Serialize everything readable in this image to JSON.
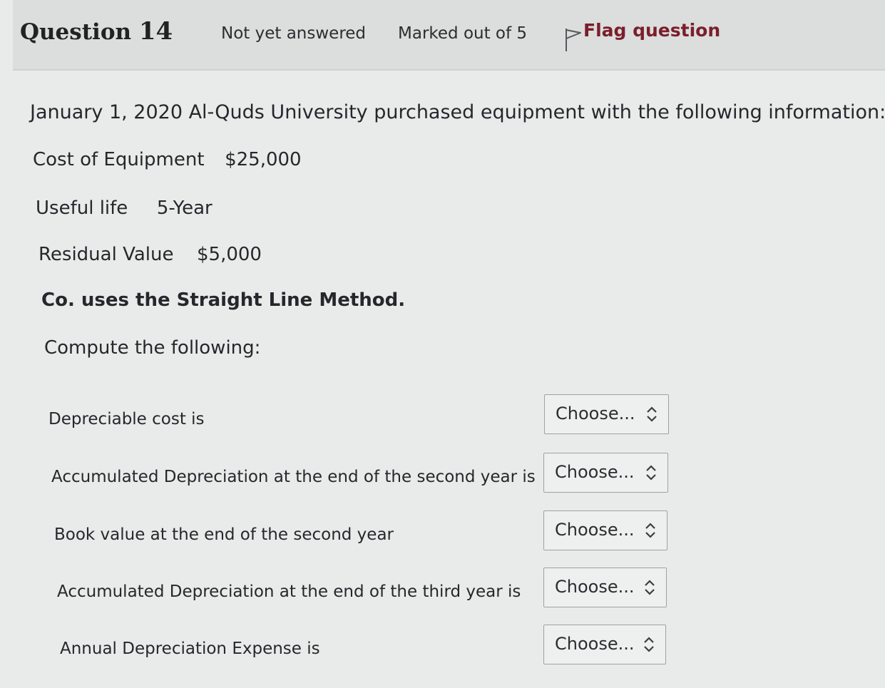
{
  "header": {
    "question_word": "Question",
    "question_number": "14",
    "status": "Not yet answered",
    "marks": "Marked out of 5",
    "flag_label": "Flag question"
  },
  "body": {
    "intro": "January 1, 2020 Al-Quds University purchased equipment with the following information:",
    "cost_label": "Cost of Equipment",
    "cost_value": "$25,000",
    "life_label": "Useful life",
    "life_value": "5-Year",
    "residual_label": "Residual Value",
    "residual_value": "$5,000",
    "method": "Co. uses the Straight Line Method.",
    "compute": "Compute the following:"
  },
  "questions": [
    {
      "label": "Depreciable cost is",
      "selected": "Choose..."
    },
    {
      "label": "Accumulated Depreciation at the end of the second year is",
      "selected": "Choose..."
    },
    {
      "label": "Book value at the end of the second year",
      "selected": "Choose..."
    },
    {
      "label": "Accumulated Depreciation at the end of the third year is",
      "selected": "Choose..."
    },
    {
      "label": "Annual Depreciation Expense is",
      "selected": "Choose..."
    }
  ],
  "icons": {
    "flag": "flag-outline-icon",
    "select": "updown-chevron-icon"
  },
  "colors": {
    "flag_text": "#7a1f2b",
    "header_bg": "#dcdddd",
    "page_bg": "#e9eaea"
  }
}
